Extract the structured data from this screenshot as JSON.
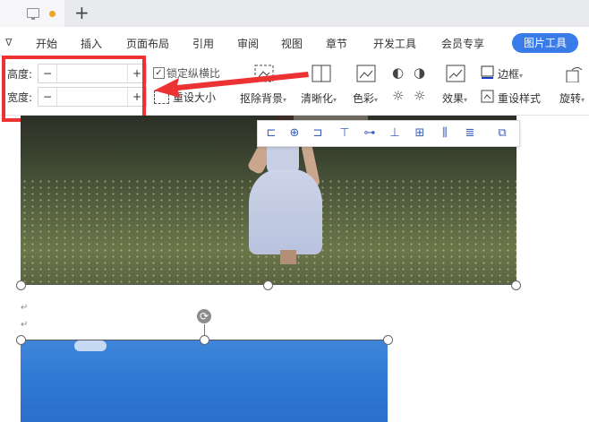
{
  "tabs": {
    "new_tab_symbol": "+"
  },
  "menu": {
    "collapse_symbol": "ᐁ",
    "items": [
      "开始",
      "插入",
      "页面布局",
      "引用",
      "审阅",
      "视图",
      "章节",
      "开发工具",
      "会员专享"
    ],
    "active_context_tab": "图片工具"
  },
  "ribbon": {
    "height_label": "高度:",
    "width_label": "宽度:",
    "height_value": "",
    "width_value": "",
    "minus_symbol": "−",
    "plus_symbol": "+",
    "lock_ratio_label": "锁定纵横比",
    "lock_ratio_checked": true,
    "reset_size_label": "重设大小",
    "tools": {
      "remove_bg": "抠除背景",
      "sharpen": "清晰化",
      "color": "色彩",
      "effects": "效果",
      "border": "边框",
      "reset_style": "重设样式",
      "rotate": "旋转"
    }
  },
  "annotation": {
    "highlight_color": "#ec3232"
  },
  "colors": {
    "accent": "#3a7bea",
    "tab_dot": "#f3a21b"
  },
  "paragraph_mark": "↵",
  "rotate_symbol": "⟳"
}
